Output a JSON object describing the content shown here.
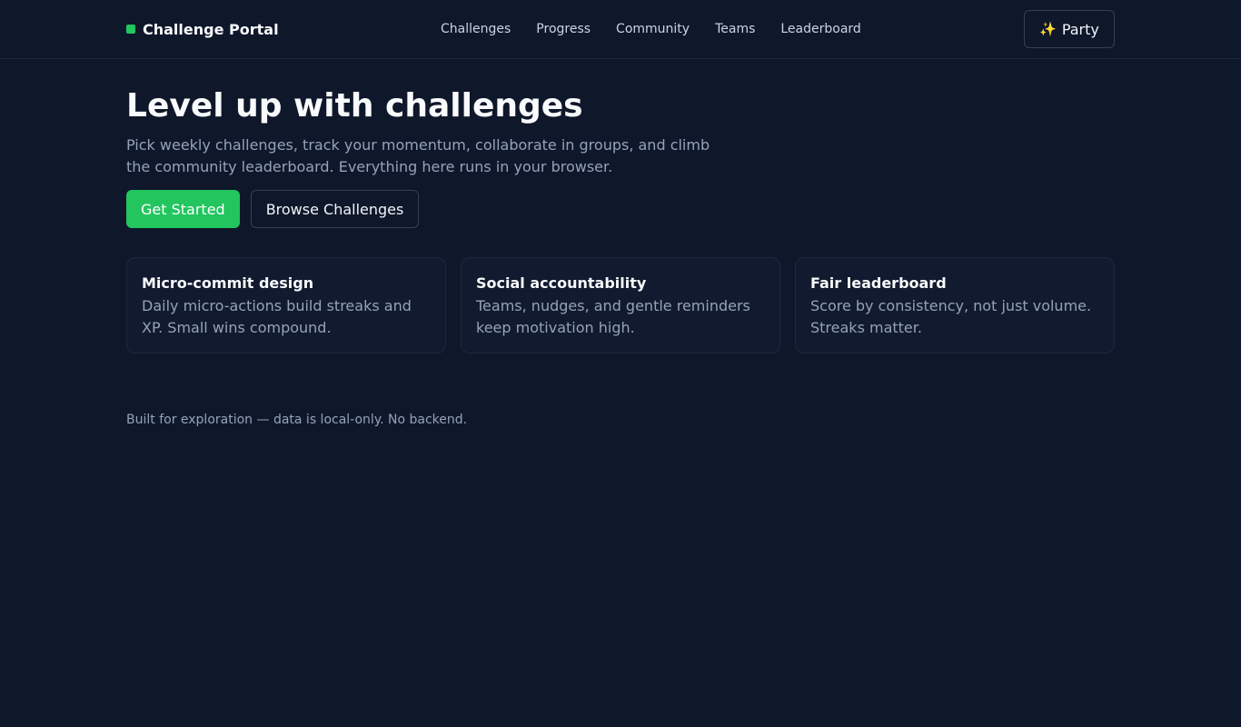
{
  "header": {
    "brand": "Challenge Portal",
    "nav": [
      "Challenges",
      "Progress",
      "Community",
      "Teams",
      "Leaderboard"
    ],
    "party_icon": "✨",
    "party_label": "Party"
  },
  "hero": {
    "title": "Level up with challenges",
    "subtitle": "Pick weekly challenges, track your momentum, collaborate in groups, and climb the community leaderboard. Everything here runs in your browser.",
    "primary_label": "Get Started",
    "secondary_label": "Browse Challenges"
  },
  "features": [
    {
      "title": "Micro-commit design",
      "text": "Daily micro-actions build streaks and XP. Small wins compound."
    },
    {
      "title": "Social accountability",
      "text": "Teams, nudges, and gentle reminders keep motivation high."
    },
    {
      "title": "Fair leaderboard",
      "text": "Score by consistency, not just volume. Streaks matter."
    }
  ],
  "footer": {
    "note": "Built for exploration — data is local-only. No backend."
  },
  "colors": {
    "background": "#0f172a",
    "accent": "#22c55e",
    "border": "#334155"
  }
}
